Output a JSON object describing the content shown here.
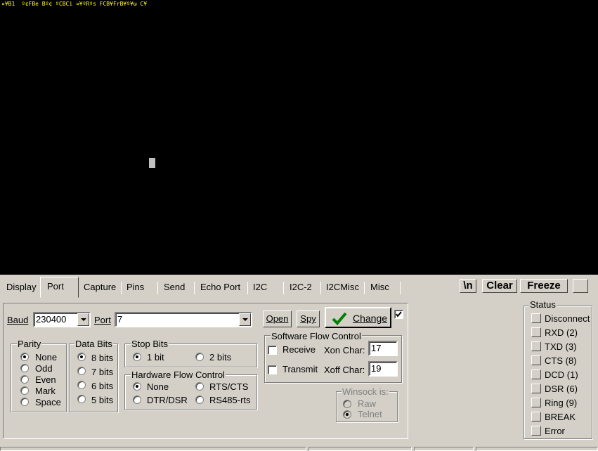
{
  "terminal": {
    "text": "¤¥B1  º¢FBe Bº¢ ºCBCi ¤¥ºRºs FCB¥FrB¥º¥ω C¥"
  },
  "tabs": [
    {
      "label": "Display",
      "active": false
    },
    {
      "label": "Port",
      "active": true
    },
    {
      "label": "Capture",
      "active": false
    },
    {
      "label": "Pins",
      "active": false
    },
    {
      "label": "Send",
      "active": false
    },
    {
      "label": "Echo Port",
      "active": false
    },
    {
      "label": "I2C",
      "active": false
    },
    {
      "label": "I2C-2",
      "active": false
    },
    {
      "label": "I2CMisc",
      "active": false
    },
    {
      "label": "Misc",
      "active": false
    }
  ],
  "toolbar": {
    "newline_label": "\\n",
    "clear_label": "Clear",
    "freeze_label": "Freeze",
    "extra_label": ""
  },
  "port": {
    "baud_label": "Baud",
    "baud_value": "230400",
    "port_label": "Port",
    "port_value": "7",
    "open_label": "Open",
    "spy_label": "Spy",
    "change_label": "Change",
    "change_checked": true
  },
  "parity": {
    "title": "Parity",
    "options": [
      "None",
      "Odd",
      "Even",
      "Mark",
      "Space"
    ],
    "selected": "None"
  },
  "databits": {
    "title": "Data Bits",
    "options": [
      "8 bits",
      "7 bits",
      "6 bits",
      "5 bits"
    ],
    "selected": "8 bits"
  },
  "stopbits": {
    "title": "Stop Bits",
    "options": [
      "1 bit",
      "2 bits"
    ],
    "selected": "1 bit"
  },
  "hwflow": {
    "title": "Hardware Flow Control",
    "options": [
      "None",
      "RTS/CTS",
      "DTR/DSR",
      "RS485-rts"
    ],
    "selected": "None"
  },
  "swflow": {
    "title": "Software Flow Control",
    "receive_label": "Receive",
    "transmit_label": "Transmit",
    "xon_label": "Xon Char:",
    "xon_value": "17",
    "xoff_label": "Xoff Char:",
    "xoff_value": "19"
  },
  "winsock": {
    "title": "Winsock is:",
    "options": [
      "Raw",
      "Telnet"
    ],
    "selected": "Telnet"
  },
  "status": {
    "title": "Status",
    "items": [
      "Disconnect",
      "RXD (2)",
      "TXD (3)",
      "CTS (8)",
      "DCD (1)",
      "DSR (6)",
      "Ring (9)",
      "BREAK",
      "Error"
    ]
  }
}
